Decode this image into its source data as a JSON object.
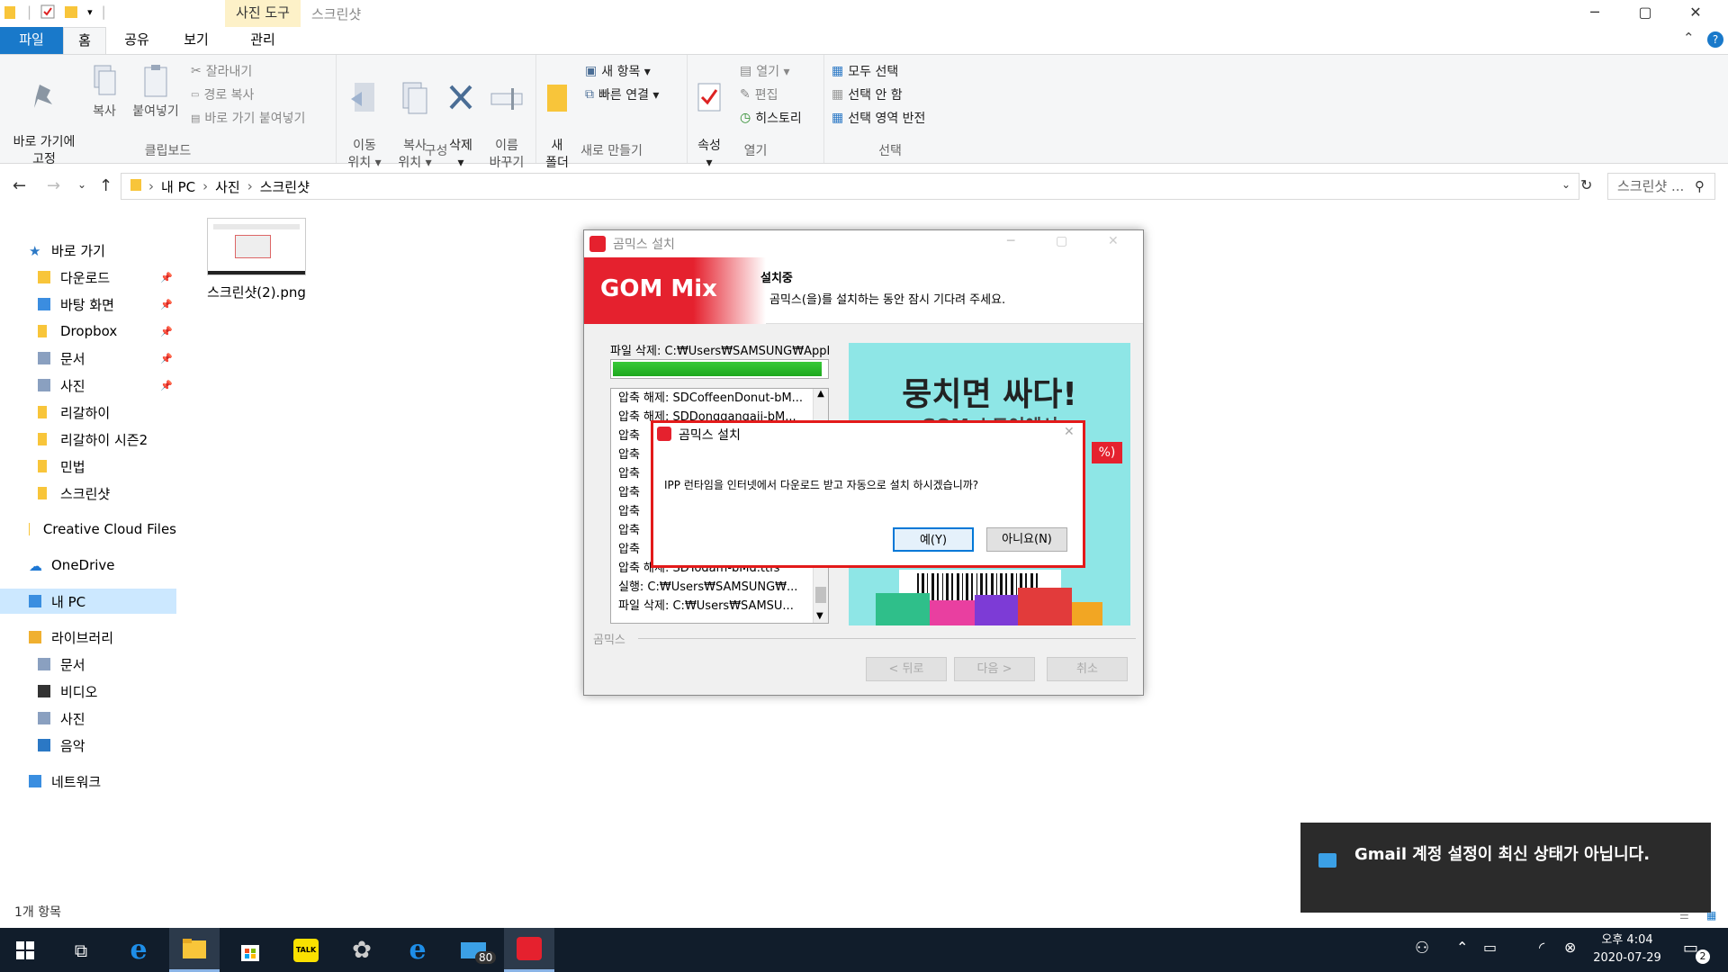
{
  "window": {
    "title": "스크린샷",
    "context_tab": "사진 도구",
    "controls": {
      "minimize": "─",
      "maximize": "▢",
      "close": "✕"
    }
  },
  "tabs": {
    "file": "파일",
    "home": "홈",
    "share": "공유",
    "view": "보기",
    "manage": "관리"
  },
  "ribbon": {
    "clipboard": {
      "label": "클립보드",
      "pin": "바로 가기에\n고정",
      "copy": "복사",
      "paste": "붙여넣기",
      "cut": "잘라내기",
      "copy_path": "경로 복사",
      "paste_shortcut": "바로 가기 붙여넣기"
    },
    "organize": {
      "label": "구성",
      "move_to": "이동\n위치 ▾",
      "copy_to": "복사\n위치 ▾",
      "delete": "삭제\n▾",
      "rename": "이름\n바꾸기"
    },
    "new": {
      "label": "새로 만들기",
      "new_folder": "새\n폴더",
      "new_item": "새 항목 ▾",
      "easy_access": "빠른 연결 ▾"
    },
    "open": {
      "label": "열기",
      "properties": "속성\n▾",
      "open": "열기 ▾",
      "edit": "편집",
      "history": "히스토리"
    },
    "select": {
      "label": "선택",
      "select_all": "모두 선택",
      "select_none": "선택 안 함",
      "invert": "선택 영역 반전"
    }
  },
  "address": {
    "crumbs": [
      "내 PC",
      "사진",
      "스크린샷"
    ],
    "search_placeholder": "스크린샷 ..."
  },
  "nav": [
    {
      "label": "바로 가기",
      "level": 0,
      "icon": "star-icon",
      "pinned": false
    },
    {
      "label": "다운로드",
      "level": 1,
      "icon": "download-folder-icon",
      "pinned": true
    },
    {
      "label": "바탕 화면",
      "level": 1,
      "icon": "desktop-folder-icon",
      "pinned": true
    },
    {
      "label": "Dropbox",
      "level": 1,
      "icon": "folder-icon",
      "pinned": true
    },
    {
      "label": "문서",
      "level": 1,
      "icon": "documents-icon",
      "pinned": true
    },
    {
      "label": "사진",
      "level": 1,
      "icon": "pictures-icon",
      "pinned": true
    },
    {
      "label": "리갈하이",
      "level": 1,
      "icon": "folder-icon",
      "pinned": false
    },
    {
      "label": "리갈하이 시즌2",
      "level": 1,
      "icon": "folder-icon",
      "pinned": false
    },
    {
      "label": "민법",
      "level": 1,
      "icon": "folder-icon",
      "pinned": false
    },
    {
      "label": "스크린샷",
      "level": 1,
      "icon": "folder-icon",
      "pinned": false
    },
    {
      "label": "Creative Cloud Files",
      "level": 0,
      "icon": "folder-icon",
      "pinned": false
    },
    {
      "label": "OneDrive",
      "level": 0,
      "icon": "cloud-icon",
      "pinned": false
    },
    {
      "label": "내 PC",
      "level": 0,
      "icon": "pc-icon",
      "pinned": false,
      "selected": true
    },
    {
      "label": "라이브러리",
      "level": 0,
      "icon": "library-icon",
      "pinned": false
    },
    {
      "label": "문서",
      "level": 1,
      "icon": "documents-icon",
      "pinned": false
    },
    {
      "label": "비디오",
      "level": 1,
      "icon": "video-icon",
      "pinned": false
    },
    {
      "label": "사진",
      "level": 1,
      "icon": "pictures-icon",
      "pinned": false
    },
    {
      "label": "음악",
      "level": 1,
      "icon": "music-icon",
      "pinned": false
    },
    {
      "label": "네트워크",
      "level": 0,
      "icon": "network-icon",
      "pinned": false
    }
  ],
  "files": [
    {
      "name": "스크린샷(2).png"
    }
  ],
  "status": "1개 항목",
  "installer": {
    "title": "곰믹스 설치",
    "logo": "GOM Mix",
    "heading": "설치중",
    "subheading": "곰믹스(을)를 설치하는 동안 잠시 기다려 주세요.",
    "current": "파일 삭제: C:₩Users₩SAMSUNG₩AppD",
    "progress": 0.98,
    "log": [
      "압축 해제: SDCoffeenDonut-bM...",
      "압축 해제: SDDonggangaji-bM...",
      "압축",
      "압축",
      "압축",
      "압축",
      "압축",
      "압축",
      "압축",
      "압축 해제: SDTodam-bMd.ttfs",
      "실행: C:₩Users₩SAMSUNG₩...",
      "파일 삭제: C:₩Users₩SAMSU..."
    ],
    "banner_title": "뭉치면 싸다!",
    "banner_sub": "GOM 스토어에서",
    "banner_badge": "%)",
    "brand": "곰믹스",
    "buttons": {
      "back": "< 뒤로",
      "next": "다음 >",
      "cancel": "취소"
    }
  },
  "dialog": {
    "title": "곰믹스 설치",
    "message": "IPP 런타임을 인터넷에서 다운로드 받고 자동으로 설치 하시겠습니까?",
    "yes": "예(Y)",
    "no": "아니요(N)"
  },
  "toast": {
    "message": "Gmail 계정 설정이 최신 상태가 아닙니다."
  },
  "taskbar": {
    "mail_badge": "80",
    "clock_time": "오후 4:04",
    "clock_date": "2020-07-29",
    "notify_count": "2"
  },
  "colors": {
    "accent": "#1979ca",
    "gom_red": "#e5212e",
    "dialog_border": "#e31a1a",
    "taskbar": "#111d2b"
  }
}
